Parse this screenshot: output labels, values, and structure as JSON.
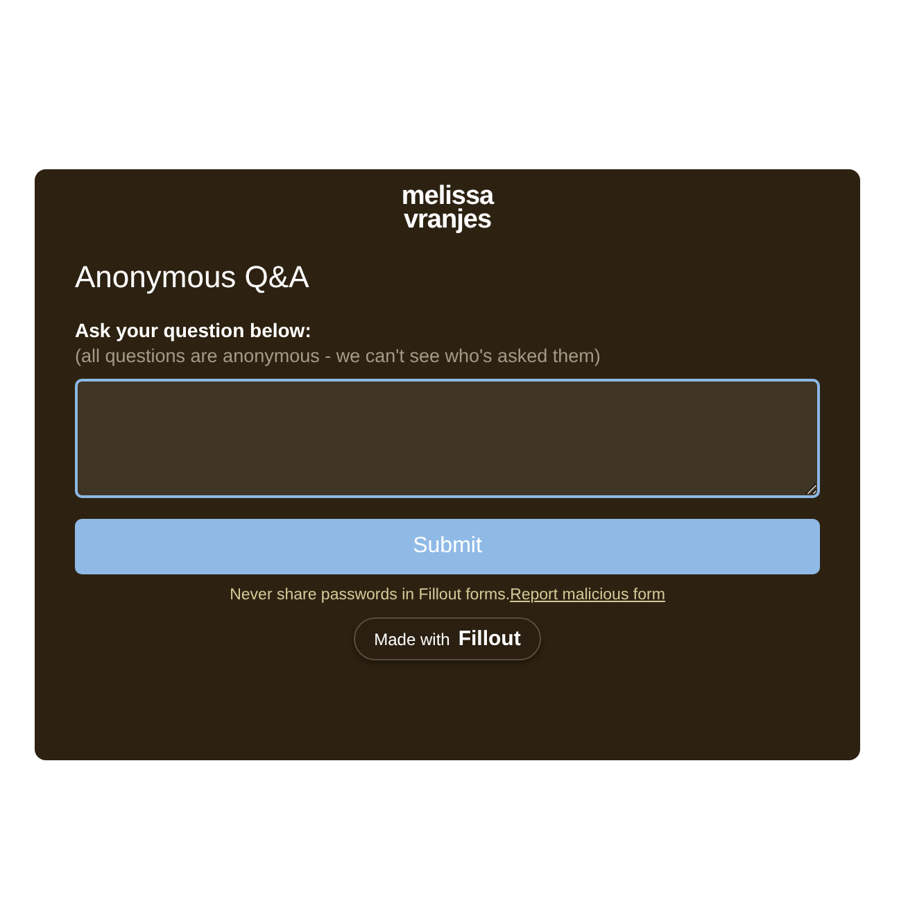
{
  "logo": {
    "lines": [
      "melissa",
      "vranjes"
    ]
  },
  "title": "Anonymous Q&A",
  "question": {
    "label": "Ask your question below:",
    "hint": "(all questions are anonymous - we can't see who's asked them)",
    "focused": true
  },
  "submit": {
    "label": "Submit"
  },
  "notice": {
    "text": "Never share passwords in Fillout forms.",
    "link": "Report malicious form"
  },
  "badge": {
    "prefix": "Made with",
    "brand": "Fillout"
  }
}
